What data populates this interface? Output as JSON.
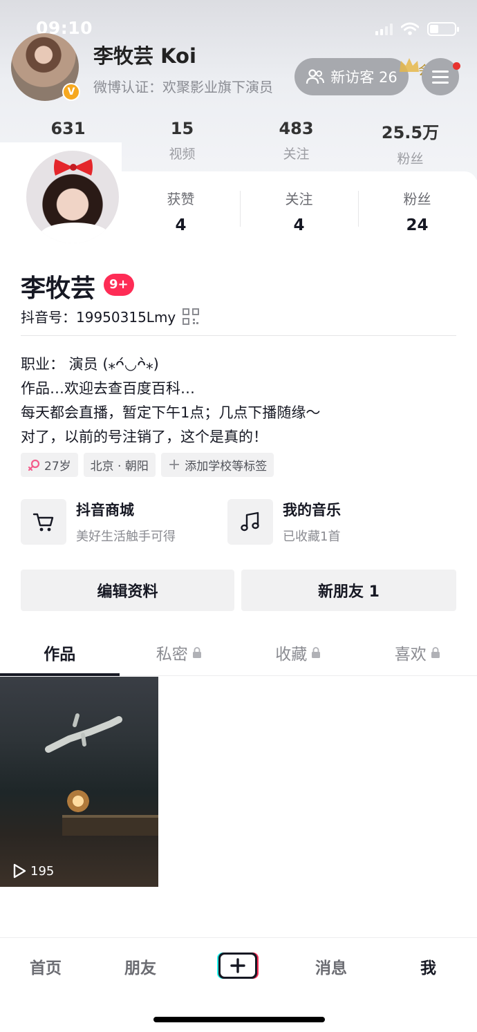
{
  "status_bar": {
    "time": "09:10"
  },
  "weibo": {
    "name": "李牧芸 Koi",
    "certification": "微博认证：欢聚影业旗下演员",
    "visitor_label": "新访客 26",
    "vip_label": "会员",
    "stats": [
      {
        "num": "631",
        "label": ""
      },
      {
        "num": "15",
        "label": "视频"
      },
      {
        "num": "483",
        "label": "关注"
      },
      {
        "num": "25.5万",
        "label": "粉丝"
      }
    ]
  },
  "douyin": {
    "stats": [
      {
        "label": "获赞",
        "num": "4"
      },
      {
        "label": "关注",
        "num": "4"
      },
      {
        "label": "粉丝",
        "num": "24"
      }
    ],
    "name": "李牧芸",
    "badge": "9+",
    "douyin_id": "抖音号：19950315Lmy",
    "bio": [
      "职业：  演员 (⁎ᴖ́◡ᴖ̀⁎)",
      "作品…欢迎去查百度百科…",
      "每天都会直播，暂定下午1点；几点下播随缘～",
      "对了，以前的号注销了，这个是真的！"
    ],
    "tags": {
      "age": "27岁",
      "location": "北京 · 朝阳",
      "add": "添加学校等标签"
    },
    "entries": {
      "mall": {
        "title": "抖音商城",
        "sub": "美好生活触手可得"
      },
      "music": {
        "title": "我的音乐",
        "sub": "已收藏1首"
      }
    },
    "buttons": {
      "edit": "编辑资料",
      "new_friends": "新朋友 1"
    },
    "tabs": [
      "作品",
      "私密",
      "收藏",
      "喜欢"
    ],
    "video": {
      "play_count": "195"
    }
  },
  "bottom_nav": {
    "home": "首页",
    "friends": "朋友",
    "messages": "消息",
    "me": "我"
  },
  "colors": {
    "accent": "#fe2c55",
    "text": "#161823",
    "vip_gold": "#b8902c",
    "cert_badge": "#f6a81f"
  }
}
